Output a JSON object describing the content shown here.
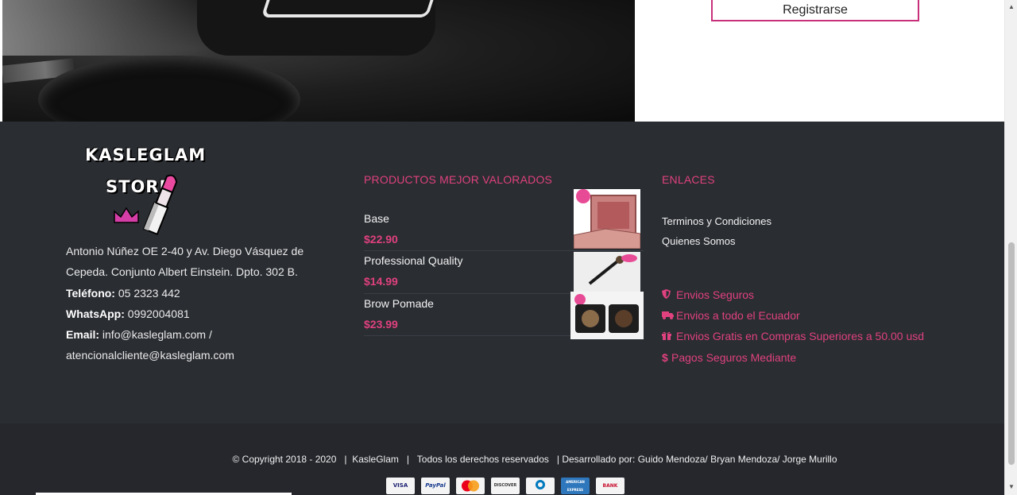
{
  "header": {
    "register_label": "Registrarse"
  },
  "brand": {
    "line1": "KASLEGLAM",
    "line2": "STORE"
  },
  "address": {
    "line": "Antonio Núñez OE 2-40 y Av. Diego Vásquez de Cepeda. Conjunto Albert Einstein. Dpto. 302 B.",
    "phone_label": "Teléfono:",
    "phone": "05 2323 442",
    "whatsapp_label": "WhatsApp:",
    "whatsapp": "0992004081",
    "email_label": "Email:",
    "email": "info@kasleglam.com / atencionalcliente@kasleglam.com"
  },
  "products": {
    "title": "PRODUCTOS MEJOR VALORADOS",
    "items": [
      {
        "name": "Base",
        "price": "$22.90"
      },
      {
        "name": "Professional Quality",
        "price": "$14.99"
      },
      {
        "name": "Brow Pomade",
        "price": "$23.99"
      }
    ]
  },
  "links": {
    "title": "ENLACES",
    "items": [
      "Terminos y Condiciones",
      "Quienes Somos"
    ]
  },
  "features": {
    "items": [
      {
        "icon": "shield-icon",
        "label": "Envios Seguros"
      },
      {
        "icon": "truck-icon",
        "label": "Envios a todo el Ecuador"
      },
      {
        "icon": "gift-icon",
        "label": "Envios Gratis en Compras Superiores a 50.00 usd"
      },
      {
        "icon": "dollar-icon",
        "label": "Pagos Seguros Mediante"
      }
    ]
  },
  "footer": {
    "copyright": "© Copyright 2018 - 2020   |  KasleGlam   |   Todos los derechos reservados   | Desarrollado por: Guido Mendoza/ Bryan Mendoza/ Jorge Murillo",
    "payments": [
      "VISA",
      "PayPal",
      "mastercard",
      "DISCOVER",
      "Diners Club",
      "AMERICAN EXPRESS",
      "BANK TRANSFER"
    ]
  },
  "colors": {
    "accent": "#e0417f",
    "footer_bg": "#2a2d32",
    "footer_bottom_bg": "#25272c"
  }
}
